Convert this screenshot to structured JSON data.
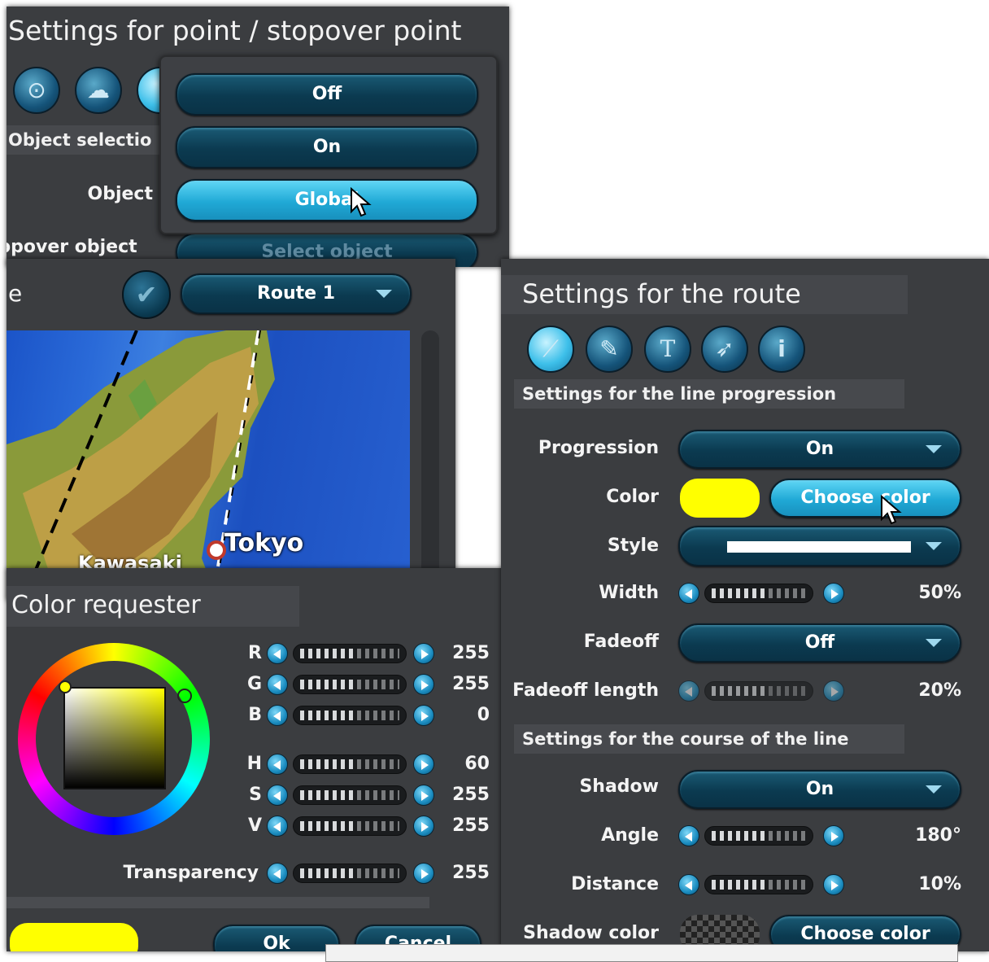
{
  "point_panel": {
    "title": "Settings for point / stopover point",
    "section": "Object selectio",
    "object_label": "Object",
    "stopover_label": "opover object",
    "select_object": "Select object",
    "tab_icons": [
      "dotted-circle-icon",
      "clouds-icon",
      "globe-icon"
    ],
    "dropdown_options": [
      "Off",
      "On",
      "Global"
    ],
    "dropdown_selected": "Global"
  },
  "map_panel": {
    "title_fragment": "e",
    "route_select": "Route 1",
    "check_icon": "checkmark-icon",
    "map_labels": [
      "Tokyo",
      "Kawasaki"
    ]
  },
  "color_panel": {
    "title": "Color requester",
    "channels": [
      {
        "name": "R",
        "value": "255",
        "level": 0.5
      },
      {
        "name": "G",
        "value": "255",
        "level": 0.5
      },
      {
        "name": "B",
        "value": "0",
        "level": 0.5
      },
      {
        "name": "H",
        "value": "60",
        "level": 0.5
      },
      {
        "name": "S",
        "value": "255",
        "level": 0.5
      },
      {
        "name": "V",
        "value": "255",
        "level": 0.5
      }
    ],
    "transparency_label": "Transparency",
    "transparency_value": "255",
    "preview_color": "#ffff00",
    "ok": "Ok",
    "cancel": "Cancel"
  },
  "route_panel": {
    "title": "Settings for the route",
    "tab_icons": [
      "line-icon",
      "brush-icon",
      "text-icon",
      "rocket-icon",
      "camera-icon"
    ],
    "section_progression": "Settings for the line progression",
    "progression_label": "Progression",
    "progression_value": "On",
    "color_label": "Color",
    "line_color": "#ffff00",
    "choose_color": "Choose color",
    "style_label": "Style",
    "width_label": "Width",
    "width_value": "50%",
    "width_level": 0.5,
    "fadeoff_label": "Fadeoff",
    "fadeoff_value": "Off",
    "fadeoff_length_label": "Fadeoff length",
    "fadeoff_length_value": "20%",
    "fadeoff_length_level": 0.5,
    "section_course": "Settings for the course of the line",
    "shadow_label": "Shadow",
    "shadow_value": "On",
    "angle_label": "Angle",
    "angle_value": "180°",
    "angle_level": 0.5,
    "distance_label": "Distance",
    "distance_value": "10%",
    "distance_level": 0.5,
    "shadow_color_label": "Shadow color",
    "shadow_choose_color": "Choose color"
  }
}
